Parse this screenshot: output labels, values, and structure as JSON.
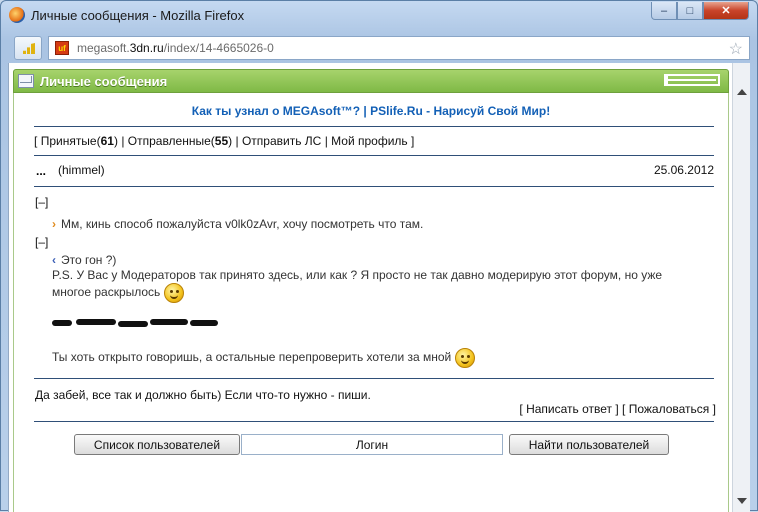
{
  "window": {
    "title": "Личные сообщения - Mozilla Firefox",
    "min_glyph": "–",
    "max_glyph": "□",
    "close_glyph": "✕"
  },
  "urlbar": {
    "url_prefix": "megasoft.",
    "url_domain": "3dn.ru",
    "url_path": "/index/14-4665026-0",
    "site_icon_text": "uf"
  },
  "panel": {
    "title": "Личные сообщения"
  },
  "ad": {
    "left": "Как ты узнал о MEGAsoft™?",
    "separator": "|",
    "right": "PSlife.Ru - Нарисуй Свой Мир!"
  },
  "nav": {
    "open_bracket": "[",
    "received_label": "Принятые(",
    "received_count": "61",
    "received_close": ")",
    "sent_label": "Отправленные(",
    "sent_count": "55",
    "sent_close": ")",
    "send_pm": "Отправить ЛС",
    "profile": "Мой профиль",
    "sep": "|",
    "close_bracket": "]"
  },
  "message": {
    "dots": "...",
    "sender": "(himmel)",
    "date": "25.06.2012",
    "quote_toggle": "[–]",
    "quote1": "Мм, кинь способ пожалуйста v0lk0zAvr, хочу посмотреть что там.",
    "quote2_line1": "Это гон ?)",
    "quote2_line2": "P.S. У Вас у Модераторов так принято здесь, или как ? Я просто не так давно модерирую этот форум, но уже многое раскрылось",
    "quote3": "Ты хоть открыто говоришь, а остальные перепроверить хотели за мной",
    "reply": "Да забей, все так и должно быть) Если что-то нужно - пиши."
  },
  "actions": {
    "open": "[",
    "write_reply": "Написать ответ",
    "mid": "] [",
    "complain": "Пожаловаться",
    "close": "]"
  },
  "bottom": {
    "users_button": "Список пользователей",
    "login_placeholder": "Логин",
    "find_button": "Найти пользователей"
  }
}
